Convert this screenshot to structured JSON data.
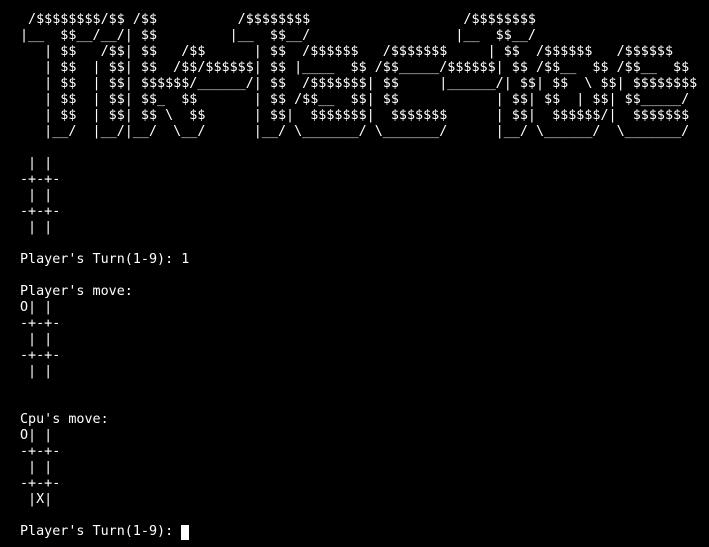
{
  "banner": [
    " /$$$$$$$$/$$ /$$          /$$$$$$$$                   /$$$$$$$$",
    "|__  $$__/__/| $$         |__  $$__/                  |__  $$__/",
    "   | $$   /$$| $$   /$$      | $$  /$$$$$$   /$$$$$$$     | $$  /$$$$$$   /$$$$$$",
    "   | $$  | $$| $$  /$$/$$$$$$| $$ |____  $$ /$$_____/$$$$$$| $$ /$$__  $$ /$$__  $$",
    "   | $$  | $$| $$$$$$/______/| $$  /$$$$$$$| $$     |______/| $$| $$  \\ $$| $$$$$$$$",
    "   | $$  | $$| $$_  $$       | $$ /$$__  $$| $$            | $$| $$  | $$| $$_____/",
    "   | $$  | $$| $$ \\  $$      | $$|  $$$$$$$|  $$$$$$$      | $$|  $$$$$$/|  $$$$$$$",
    "   |__/  |__/|__/  \\__/      |__/ \\_______/ \\_______/      |__/ \\______/  \\_______/"
  ],
  "initial_board": [
    " | |",
    "-+-+-",
    " | |",
    "-+-+-",
    " | |"
  ],
  "turn_prompt_1": "Player's Turn(1-9): 1",
  "player_move_label": "Player's move:",
  "player_board": [
    "O| |",
    "-+-+-",
    " | |",
    "-+-+-",
    " | |"
  ],
  "cpu_move_label": "Cpu's move:",
  "cpu_board": [
    "O| |",
    "-+-+-",
    " | |",
    "-+-+-",
    " |X|"
  ],
  "turn_prompt_2": "Player's Turn(1-9): "
}
